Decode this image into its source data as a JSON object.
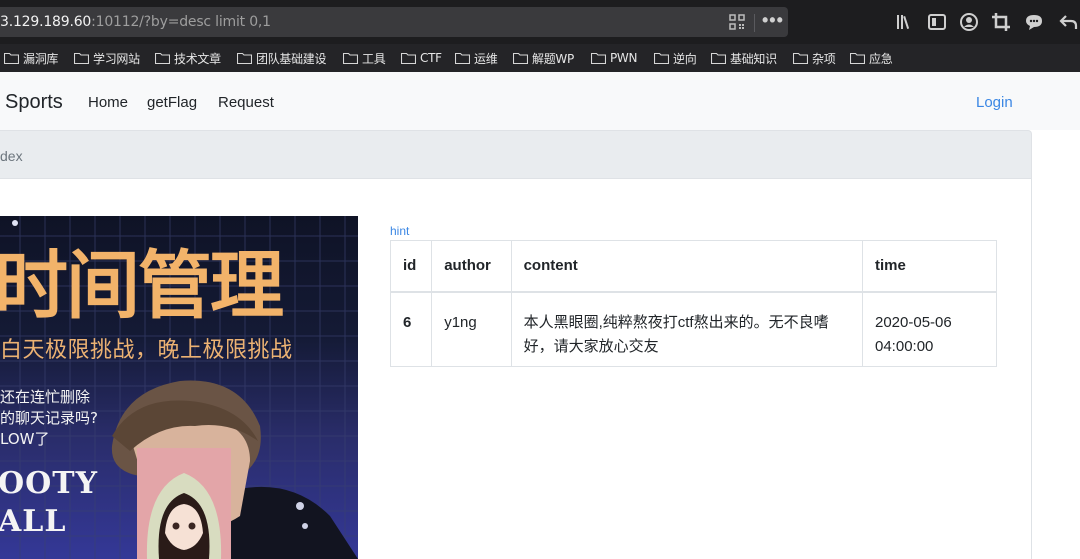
{
  "browser": {
    "url_host": "3.129.189.60",
    "url_rest": ":10112/?by=desc limit 0,1",
    "more_label": "•••",
    "toolbar_icons": [
      "library-icon",
      "sidebar-icon",
      "account-icon",
      "crop-icon",
      "chat-icon",
      "back-icon"
    ],
    "bookmarks": [
      "漏洞库",
      "学习网站",
      "技术文章",
      "团队基础建设",
      "工具",
      "CTF",
      "运维",
      "解题WP",
      "PWN",
      "逆向",
      "基础知识",
      "杂项",
      "应急"
    ]
  },
  "nav": {
    "brand": "Sports",
    "links": [
      "Home",
      "getFlag",
      "Request"
    ],
    "login": "Login"
  },
  "breadcrumb": {
    "current": "dex"
  },
  "poster": {
    "title": "时间管理",
    "subtitle": "白天极限挑战，晚上极限挑战",
    "question_lines": [
      "还在连忙删除",
      "的聊天记录吗?",
      "LOW了"
    ],
    "big_lines": [
      "OOTY",
      "ALL"
    ]
  },
  "hint": "hint",
  "table": {
    "headers": [
      "id",
      "author",
      "content",
      "time"
    ],
    "rows": [
      {
        "id": "6",
        "author": "y1ng",
        "content": "本人黑眼圈,纯粹熬夜打ctf熬出来的。无不良嗜好，请大家放心交友",
        "time": "2020-05-06 04:00:00"
      }
    ]
  },
  "colors": {
    "link": "#3b87e4",
    "poster_text": "#f2b36a",
    "chrome_bg": "#1d1d1f"
  }
}
